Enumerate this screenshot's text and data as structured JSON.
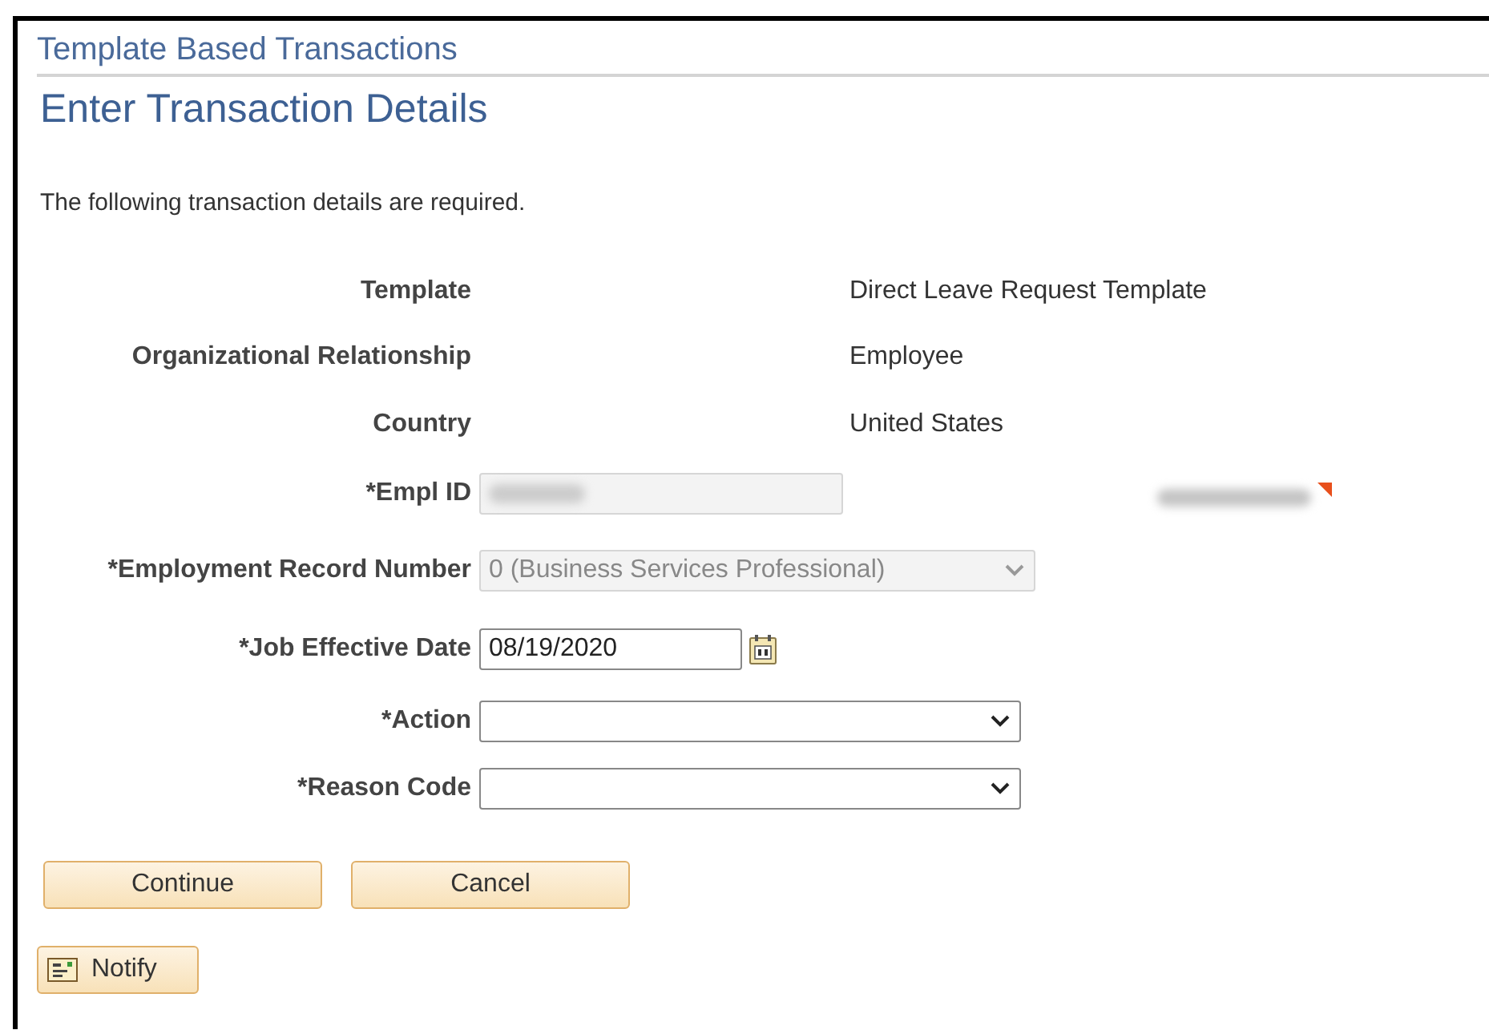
{
  "breadcrumb": "Template Based Transactions",
  "title": "Enter Transaction Details",
  "instructions": "The following transaction details are required.",
  "fields": [
    {
      "kind": "info",
      "label": "Template",
      "value": "Direct Leave Request Template"
    },
    {
      "kind": "info",
      "label": "Organizational Relationship",
      "value": "Employee"
    },
    {
      "kind": "info",
      "label": "Country",
      "value": "United States"
    },
    {
      "kind": "text",
      "label": "*Empl ID",
      "disabled": true,
      "redacted": true,
      "name_redacted": true
    },
    {
      "kind": "select",
      "label": "*Employment Record Number",
      "disabled": true,
      "value": "0 (Business Services Professional)"
    },
    {
      "kind": "date",
      "label": "*Job Effective Date",
      "disabled": false,
      "value": "08/19/2020"
    },
    {
      "kind": "select",
      "label": "*Action",
      "disabled": false
    },
    {
      "kind": "select",
      "label": "*Reason Code",
      "disabled": false
    }
  ],
  "buttons": [
    "Continue",
    "Cancel"
  ],
  "notify": "Notify"
}
